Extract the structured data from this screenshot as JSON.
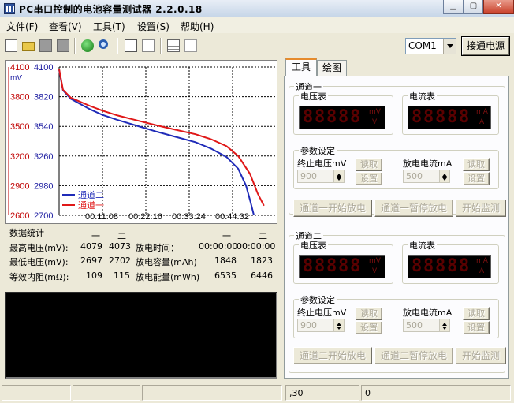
{
  "window": {
    "title": "PC串口控制的电池容量测试器 2.2.0.18"
  },
  "menu": [
    "文件(F)",
    "查看(V)",
    "工具(T)",
    "设置(S)",
    "帮助(H)"
  ],
  "toolbar": {
    "com_port": "COM1",
    "connect_label": "接通电源"
  },
  "chart_data": {
    "type": "line",
    "y_left_label": "mV",
    "y_left_ticks": [
      4100,
      3800,
      3500,
      3200,
      2900,
      2600
    ],
    "y_right_ticks": [
      4100,
      3820,
      3540,
      3260,
      2980,
      2700
    ],
    "x_ticks": [
      "00:11:08",
      "00:22:16",
      "00:33:24",
      "00:44:32"
    ],
    "grid": true,
    "legend_position": "bottom-left",
    "colors": {
      "channel2": "#1f2bb8",
      "channel1": "#e01818",
      "left_axis": "#c00000",
      "right_axis": "#1a1aa0"
    },
    "series": [
      {
        "name": "通道二",
        "axis": "right",
        "x_min": [
          0,
          1,
          3,
          5,
          8,
          11,
          15,
          20,
          25,
          30,
          35,
          39,
          43,
          46,
          48,
          49.2,
          50
        ],
        "y": [
          4073,
          3880,
          3800,
          3760,
          3700,
          3650,
          3600,
          3545,
          3490,
          3440,
          3390,
          3330,
          3250,
          3140,
          2980,
          2820,
          2702
        ]
      },
      {
        "name": "通道一",
        "axis": "left",
        "x_min": [
          0,
          1,
          3,
          5,
          8,
          11,
          15,
          20,
          25,
          30,
          35,
          39,
          43,
          46,
          49,
          51,
          52.6
        ],
        "y": [
          4079,
          3870,
          3790,
          3755,
          3705,
          3660,
          3610,
          3560,
          3510,
          3465,
          3420,
          3370,
          3300,
          3200,
          3020,
          2820,
          2697
        ]
      }
    ]
  },
  "stats": {
    "title": "数据统计",
    "col_1": "一",
    "col_2": "二",
    "max_voltage_label": "最高电压(mV):",
    "max_voltage_1": "4079",
    "max_voltage_2": "4073",
    "min_voltage_label": "最低电压(mV):",
    "min_voltage_1": "2697",
    "min_voltage_2": "2702",
    "resistance_label": "等效内阻(mΩ):",
    "resistance_1": "109",
    "resistance_2": "115",
    "time_label": "放电时间：",
    "time_1": "00:00:00",
    "time_2": "00:00:00",
    "capacity_label": "放电容量(mAh)",
    "capacity_1": "1848",
    "capacity_2": "1823",
    "energy_label": "放电能量(mWh)",
    "energy_1": "6535",
    "energy_2": "6446"
  },
  "tabs": [
    "工具",
    "绘图"
  ],
  "channel1": {
    "title": "通道一",
    "voltmeter_label": "电压表",
    "ammeter_label": "电流表",
    "volt_unit_top": "mV",
    "volt_unit_bottom": "V",
    "amp_unit_top": "mA",
    "amp_unit_bottom": "A",
    "params_label": "参数设定",
    "cutoff_label": "终止电压mV",
    "cutoff_value": "900",
    "current_label": "放电电流mA",
    "current_value": "500",
    "read": "读取",
    "set": "设置",
    "start": "通道一开始放电",
    "pause": "通道一暂停放电",
    "monitor": "开始监测"
  },
  "channel2": {
    "title": "通道二",
    "voltmeter_label": "电压表",
    "ammeter_label": "电流表",
    "volt_unit_top": "mV",
    "volt_unit_bottom": "V",
    "amp_unit_top": "mA",
    "amp_unit_bottom": "A",
    "params_label": "参数设定",
    "cutoff_label": "终止电压mV",
    "cutoff_value": "900",
    "current_label": "放电电流mA",
    "current_value": "500",
    "read": "读取",
    "set": "设置",
    "start": "通道二开始放电",
    "pause": "通道二暂停放电",
    "monitor": "开始监测"
  },
  "statusbar": {
    "field_3": ",30",
    "field_4": "0"
  }
}
